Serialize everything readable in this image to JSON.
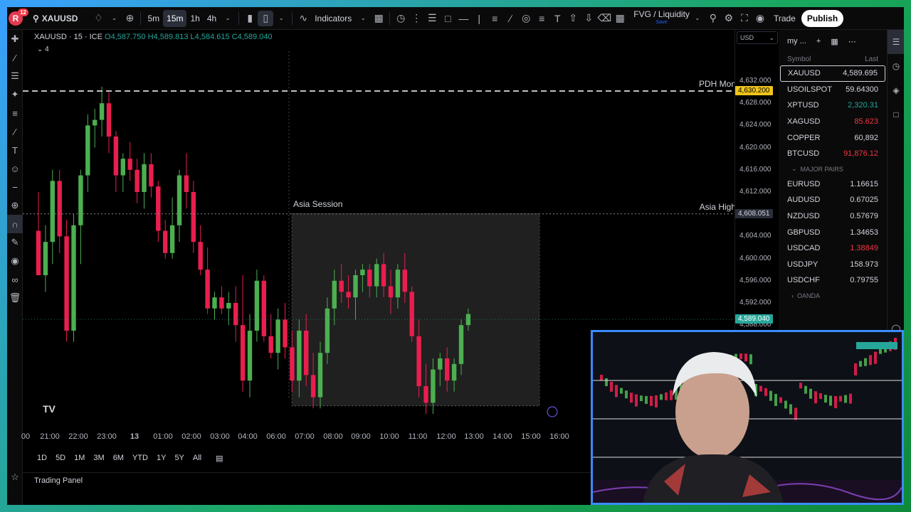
{
  "topbar": {
    "notification_count": "12",
    "avatar_letter": "R",
    "symbol": "XAUUSD",
    "intervals": [
      "5m",
      "15m",
      "1h",
      "4h"
    ],
    "active_interval": "15m",
    "indicators_label": "Indicators",
    "layout_name": "FVG / Liquidity",
    "layout_sub": "Save",
    "trade_label": "Trade",
    "publish_label": "Publish"
  },
  "legend": {
    "title": "XAUUSD · 15 · ICE",
    "open": "O4,587.750",
    "high": "H4,589.813",
    "low": "L4,584.615",
    "close": "C4,589.040",
    "indicator_count": "4"
  },
  "chart_data": {
    "type": "candlestick",
    "symbol": "XAUUSD",
    "interval": "15",
    "ylim": [
      4586,
      4633
    ],
    "price_ticks": [
      "4,632.000",
      "4,628.000",
      "4,624.000",
      "4,620.000",
      "4,616.000",
      "4,612.000",
      "4,604.000",
      "4,600.000",
      "4,596.000",
      "4,592.000",
      "4,588.000"
    ],
    "time_ticks": [
      "00",
      "21:00",
      "22:00",
      "23:00",
      "13",
      "01:00",
      "02:00",
      "03:00",
      "04:00",
      "06:00",
      "07:00",
      "08:00",
      "09:00",
      "10:00",
      "11:00",
      "12:00",
      "13:00",
      "14:00",
      "15:00",
      "16:00"
    ],
    "levels": [
      {
        "label": "PDH Mon",
        "price": 4630.2,
        "badge": "4,630.200",
        "style": "dashed"
      },
      {
        "label": "Asia High",
        "price": 4608.051,
        "badge": "4,608.051",
        "style": "dotted"
      }
    ],
    "session_box": {
      "label": "Asia Session"
    },
    "last_price": "4,589.040",
    "candles": [
      [
        4605,
        4612,
        4601,
        4597
      ],
      [
        4597,
        4606,
        4594,
        4603
      ],
      [
        4603,
        4616,
        4599,
        4614
      ],
      [
        4614,
        4616,
        4601,
        4604
      ],
      [
        4604,
        4607,
        4585,
        4587
      ],
      [
        4587,
        4608,
        4585,
        4606
      ],
      [
        4606,
        4616,
        4599,
        4615
      ],
      [
        4615,
        4626,
        4612,
        4624
      ],
      [
        4624,
        4627,
        4620,
        4625
      ],
      [
        4625,
        4631,
        4622,
        4628
      ],
      [
        4628,
        4630,
        4619,
        4622
      ],
      [
        4622,
        4623,
        4612,
        4615
      ],
      [
        4615,
        4619,
        4612,
        4618
      ],
      [
        4618,
        4621,
        4614,
        4616
      ],
      [
        4616,
        4618,
        4610,
        4612
      ],
      [
        4612,
        4619,
        4609,
        4617
      ],
      [
        4617,
        4619,
        4611,
        4613
      ],
      [
        4613,
        4614,
        4603,
        4605
      ],
      [
        4605,
        4607,
        4600,
        4601
      ],
      [
        4601,
        4611,
        4600,
        4606
      ],
      [
        4606,
        4616,
        4603,
        4615
      ],
      [
        4615,
        4619,
        4609,
        4612
      ],
      [
        4612,
        4614,
        4601,
        4603
      ],
      [
        4603,
        4606,
        4597,
        4598
      ],
      [
        4598,
        4602,
        4590,
        4591
      ],
      [
        4591,
        4594,
        4589,
        4593
      ],
      [
        4593,
        4595,
        4590,
        4591
      ],
      [
        4591,
        4594,
        4588,
        4592
      ],
      [
        4592,
        4595,
        4585,
        4588
      ],
      [
        4588,
        4597,
        4576,
        4578
      ],
      [
        4578,
        4590,
        4575,
        4587
      ],
      [
        4587,
        4598,
        4585,
        4596
      ],
      [
        4596,
        4597,
        4585,
        4586
      ],
      [
        4586,
        4590,
        4582,
        4583
      ],
      [
        4583,
        4591,
        4580,
        4589
      ],
      [
        4589,
        4592,
        4582,
        4584
      ],
      [
        4584,
        4587,
        4576,
        4578
      ],
      [
        4578,
        4589,
        4575,
        4587
      ],
      [
        4587,
        4590,
        4577,
        4579
      ],
      [
        4579,
        4583,
        4573,
        4575
      ],
      [
        4575,
        4585,
        4573,
        4583
      ],
      [
        4583,
        4593,
        4581,
        4591
      ],
      [
        4591,
        4598,
        4588,
        4596
      ],
      [
        4596,
        4599,
        4592,
        4594
      ],
      [
        4594,
        4597,
        4591,
        4593
      ],
      [
        4593,
        4598,
        4589,
        4597
      ],
      [
        4597,
        4599,
        4594,
        4598
      ],
      [
        4598,
        4599,
        4593,
        4595
      ],
      [
        4595,
        4600,
        4593,
        4599
      ],
      [
        4599,
        4601,
        4593,
        4595
      ],
      [
        4595,
        4598,
        4590,
        4593
      ],
      [
        4593,
        4599,
        4591,
        4598
      ],
      [
        4598,
        4601,
        4592,
        4594
      ],
      [
        4594,
        4595,
        4585,
        4586
      ],
      [
        4586,
        4589,
        4575,
        4577
      ],
      [
        4577,
        4581,
        4572,
        4574
      ],
      [
        4574,
        4582,
        4572,
        4580
      ],
      [
        4580,
        4583,
        4577,
        4582
      ],
      [
        4582,
        4584,
        4576,
        4578
      ],
      [
        4578,
        4582,
        4576,
        4581
      ],
      [
        4581,
        4589,
        4579,
        4588
      ],
      [
        4588,
        4591,
        4587,
        4590
      ]
    ]
  },
  "time_ranges": [
    "1D",
    "5D",
    "1M",
    "3M",
    "6M",
    "YTD",
    "1Y",
    "5Y",
    "All"
  ],
  "trading_panel_label": "Trading Panel",
  "watchlist": {
    "name": "my ...",
    "col_symbol": "Symbol",
    "col_last": "Last",
    "rows": [
      {
        "symbol": "XAUUSD",
        "last": "4,589.695",
        "dir": "up",
        "selected": true
      },
      {
        "symbol": "USOILSPOT",
        "last": "59.64300",
        "dir": "dn"
      },
      {
        "symbol": "XPTUSD",
        "last": "2,320.31",
        "dir": "up"
      },
      {
        "symbol": "XAGUSD",
        "last": "85.623",
        "dir": "dn"
      },
      {
        "symbol": "COPPER",
        "last": "60,892",
        "dir": "up"
      },
      {
        "symbol": "BTCUSD",
        "last": "91,876.12",
        "dir": "dn"
      }
    ],
    "group_major": "MAJOR PAIRS",
    "major_rows": [
      {
        "symbol": "EURUSD",
        "last": "1.16615",
        "dir": "dn"
      },
      {
        "symbol": "AUDUSD",
        "last": "0.67025",
        "dir": "dn"
      },
      {
        "symbol": "NZDUSD",
        "last": "0.57679",
        "dir": "dn"
      },
      {
        "symbol": "GBPUSD",
        "last": "1.34653",
        "dir": "dn"
      },
      {
        "symbol": "USDCAD",
        "last": "1.38849",
        "dir": "dn"
      },
      {
        "symbol": "USDJPY",
        "last": "158.973",
        "dir": "up"
      },
      {
        "symbol": "USDCHF",
        "last": "0.79755",
        "dir": "dn"
      }
    ],
    "group_oanda": "OANDA"
  },
  "currency": "USD",
  "colors": {
    "up": "#26a69a",
    "down": "#f23645",
    "candle_up": "#4caf50",
    "candle_down": "#e91e4f",
    "frame": "#3b8cff"
  }
}
